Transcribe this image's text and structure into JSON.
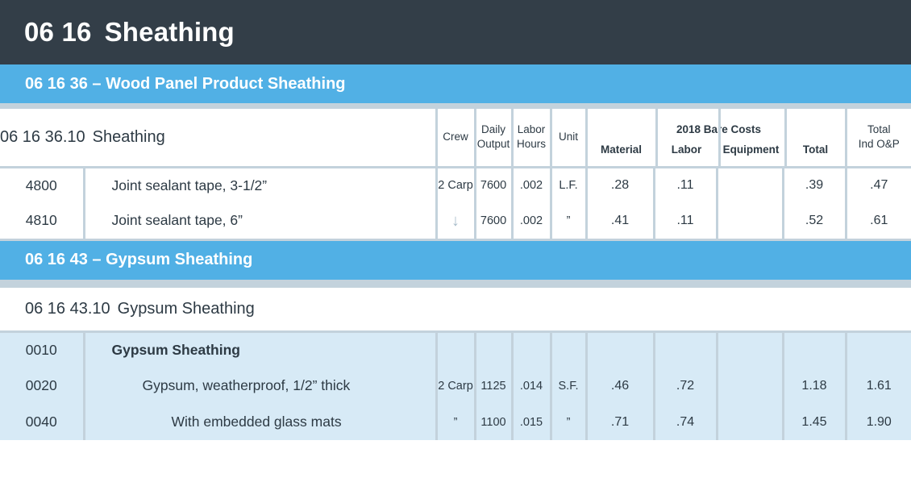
{
  "header": {
    "division_number": "06 16",
    "division_title": "Sheathing"
  },
  "sections": [
    {
      "band_label": "06 16 36 – Wood Panel Product Sheathing",
      "subhead_code": "06 16 36.10",
      "subhead_title": "Sheathing",
      "columns": {
        "crew": "Crew",
        "daily": "Daily",
        "output": "Output",
        "labor": "Labor",
        "hours": "Hours",
        "unit": "Unit",
        "bare_costs_group": "2018 Bare Costs",
        "material": "Material",
        "labor_cost": "Labor",
        "equipment": "Equipment",
        "total": "Total",
        "total_incl": "Total",
        "total_incl2": "Ind O&P"
      },
      "rows": [
        {
          "number": "4800",
          "description": "Joint sealant tape, 3-1/2”",
          "indent": 0,
          "bold": false,
          "crew": "2 Carp",
          "crew_is_arrow": false,
          "daily_output": "7600",
          "labor_hours": ".002",
          "unit": "L.F.",
          "material": ".28",
          "labor": ".11",
          "equipment": "",
          "total": ".39",
          "total_incl_oap": ".47"
        },
        {
          "number": "4810",
          "description": "Joint sealant tape, 6”",
          "indent": 0,
          "bold": false,
          "crew": "↓",
          "crew_is_arrow": true,
          "daily_output": "7600",
          "labor_hours": ".002",
          "unit": "”",
          "material": ".41",
          "labor": ".11",
          "equipment": "",
          "total": ".52",
          "total_incl_oap": ".61"
        }
      ]
    },
    {
      "band_label": "06 16 43 – Gypsum Sheathing",
      "subhead_code": "06 16 43.10",
      "subhead_title": "Gypsum Sheathing",
      "rows": [
        {
          "number": "0010",
          "description": "Gypsum Sheathing",
          "indent": 0,
          "bold": true,
          "crew": "",
          "crew_is_arrow": false,
          "daily_output": "",
          "labor_hours": "",
          "unit": "",
          "material": "",
          "labor": "",
          "equipment": "",
          "total": "",
          "total_incl_oap": ""
        },
        {
          "number": "0020",
          "description": "Gypsum, weatherproof, 1/2” thick",
          "indent": 1,
          "bold": false,
          "crew": "2 Carp",
          "crew_is_arrow": false,
          "daily_output": "1125",
          "labor_hours": ".014",
          "unit": "S.F.",
          "material": ".46",
          "labor": ".72",
          "equipment": "",
          "total": "1.18",
          "total_incl_oap": "1.61"
        },
        {
          "number": "0040",
          "description": "With embedded glass mats",
          "indent": 2,
          "bold": false,
          "crew": "”",
          "crew_is_arrow": false,
          "daily_output": "1100",
          "labor_hours": ".015",
          "unit": "”",
          "material": ".71",
          "labor": ".74",
          "equipment": "",
          "total": "1.45",
          "total_incl_oap": "1.90"
        }
      ]
    }
  ],
  "colors": {
    "title_bar": "#333e48",
    "band_blue": "#51b0e5",
    "grid": "#c3d2dc",
    "row_highlight": "#d7eaf6",
    "text": "#2d3a44"
  }
}
